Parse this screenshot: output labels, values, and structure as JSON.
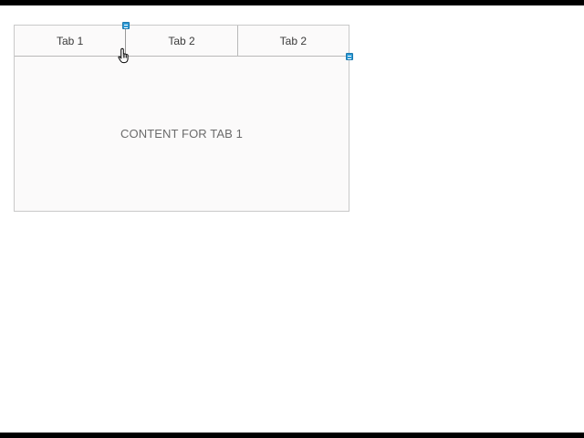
{
  "tabs": [
    {
      "label": "Tab 1"
    },
    {
      "label": "Tab 2"
    },
    {
      "label": "Tab 2"
    }
  ],
  "content": {
    "text": "CONTENT FOR TAB 1"
  },
  "colors": {
    "handle": "#2f9bd6",
    "border": "#c9c9c9"
  },
  "icons": {
    "cursor": "hand-pointer-icon",
    "resize_handle": "resize-handle-icon"
  }
}
